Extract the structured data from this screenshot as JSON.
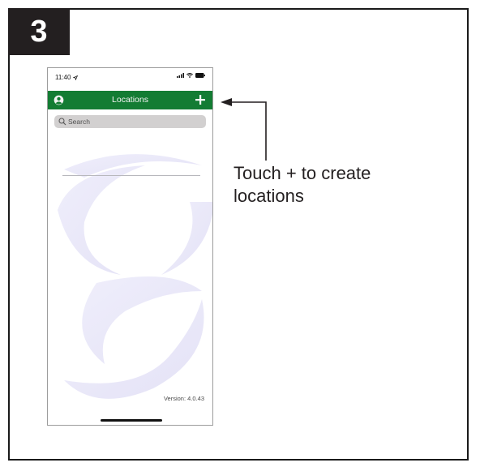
{
  "step": {
    "number": "3"
  },
  "phone": {
    "status_bar": {
      "time": "11:40",
      "icons": [
        "location-arrow-icon",
        "signal-icon",
        "wifi-icon",
        "battery-icon"
      ]
    },
    "app_bar": {
      "title": "Locations",
      "left_icon": "account-icon",
      "right_icon": "plus-icon",
      "color": "#137c33"
    },
    "search": {
      "placeholder": "Search",
      "value": ""
    },
    "version_text": "Version: 4.0.43"
  },
  "callout": {
    "line1": "Touch + to create",
    "line2": "locations"
  }
}
